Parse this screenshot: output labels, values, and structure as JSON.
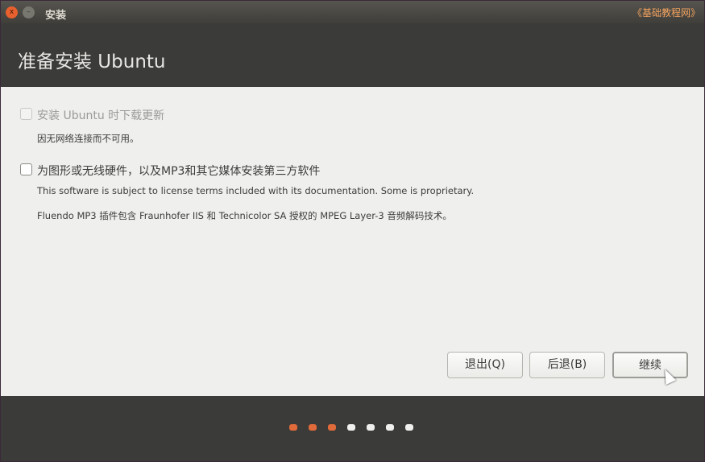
{
  "window": {
    "title": "安装",
    "watermark": "《基础教程网》",
    "close": "x",
    "minimize": "–"
  },
  "header": {
    "title": "准备安装 Ubuntu"
  },
  "options": [
    {
      "label": "安装 Ubuntu 时下载更新",
      "checked": false,
      "disabled": true,
      "notes": [
        "因无网络连接而不可用。"
      ]
    },
    {
      "label": "为图形或无线硬件，以及MP3和其它媒体安装第三方软件",
      "checked": false,
      "disabled": false,
      "notes": [
        "This software is subject to license terms included with its documentation. Some is proprietary.",
        "Fluendo MP3 插件包含 Fraunhofer IIS 和 Technicolor SA 授权的 MPEG Layer-3 音频解码技术。"
      ]
    }
  ],
  "buttons": {
    "quit": "退出(Q)",
    "back": "后退(B)",
    "continue": "继续"
  },
  "progress": {
    "current_step": 3,
    "total_steps": 7,
    "active_color": "#e06a3a",
    "inactive_color": "#f0f0ee"
  }
}
